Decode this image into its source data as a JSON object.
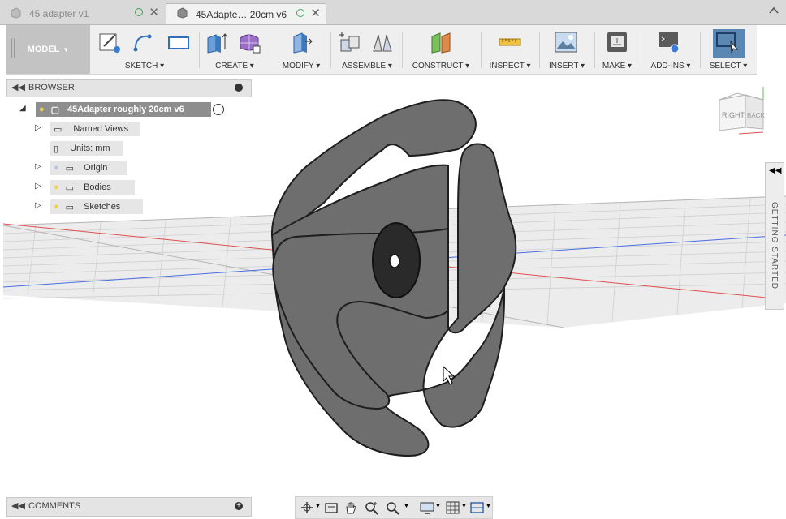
{
  "tabs": [
    {
      "label": "45 adapter v1",
      "active": false
    },
    {
      "label": "45Adapte… 20cm v6",
      "active": true
    }
  ],
  "toolbar": {
    "model_label": "MODEL",
    "groups": [
      {
        "label": "SKETCH"
      },
      {
        "label": "CREATE"
      },
      {
        "label": "MODIFY"
      },
      {
        "label": "ASSEMBLE"
      },
      {
        "label": "CONSTRUCT"
      },
      {
        "label": "INSPECT"
      },
      {
        "label": "INSERT"
      },
      {
        "label": "MAKE"
      },
      {
        "label": "ADD-INS"
      },
      {
        "label": "SELECT"
      }
    ]
  },
  "browser": {
    "title": "BROWSER",
    "root": "45Adapter roughly 20cm v6",
    "items": [
      {
        "label": "Named Views"
      },
      {
        "label": "Units: mm"
      },
      {
        "label": "Origin"
      },
      {
        "label": "Bodies"
      },
      {
        "label": "Sketches"
      }
    ]
  },
  "comments": {
    "title": "COMMENTS"
  },
  "side_panel": {
    "label": "GETTING STARTED"
  },
  "viewcube": {
    "right": "RIGHT",
    "back": "BACK"
  },
  "colors": {
    "accent": "#5b88b3",
    "body": "#6e6e6e",
    "edge": "#1e1e1e"
  }
}
